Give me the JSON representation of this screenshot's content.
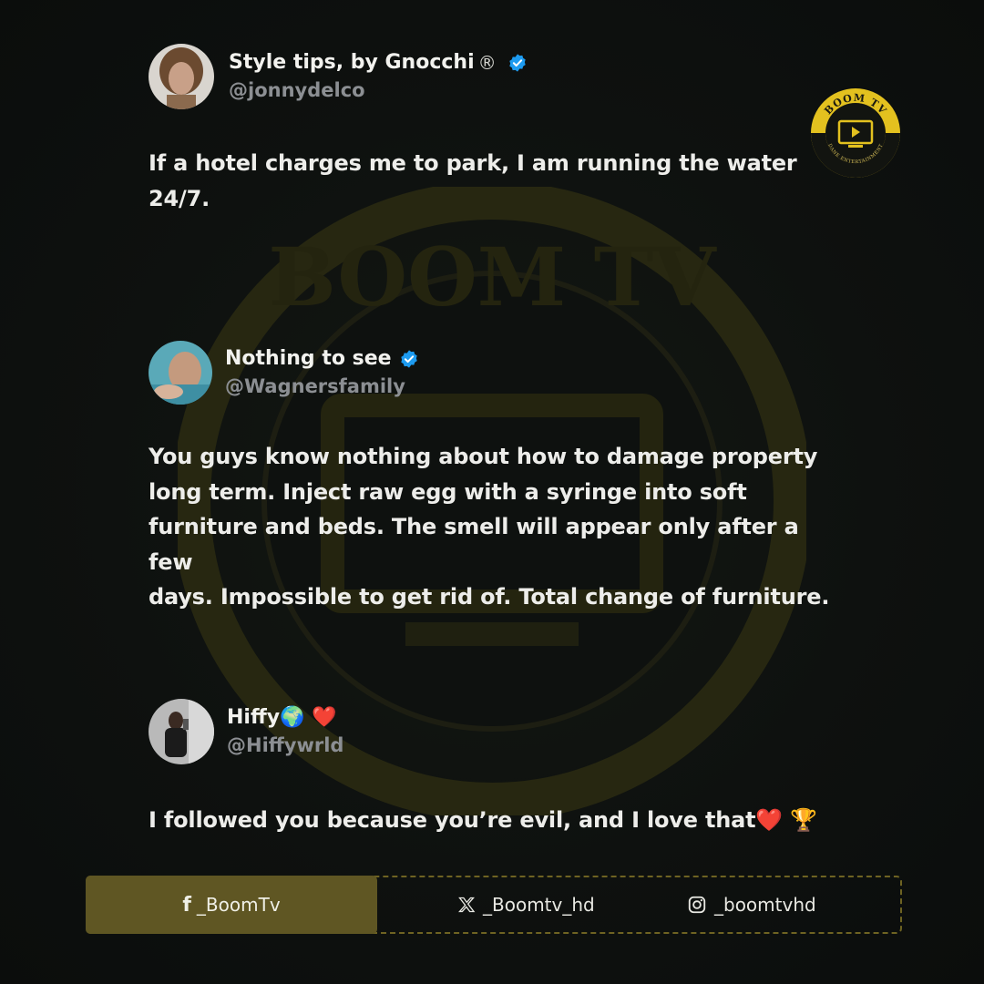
{
  "logo": {
    "text": "BOOM TV",
    "subtext": "DANE ENTERTAINMENT",
    "icon": "play-screen-icon",
    "color": "#e3c11f"
  },
  "tweets": [
    {
      "display_name": "Style tips, by Gnocchi",
      "name_suffix": "®",
      "handle": "@jonnydelco",
      "verified": true,
      "text_lines": [
        "If a hotel charges me to park, I am running the water",
        "24/7."
      ]
    },
    {
      "display_name": "Nothing to see",
      "handle": "@Wagnersfamily",
      "verified": true,
      "text_lines": [
        "You guys know nothing about how to damage property",
        "long term. Inject raw egg with a syringe into soft",
        "furniture and beds. The smell will appear only after a few",
        "days. Impossible to get rid of. Total change of furniture."
      ]
    },
    {
      "display_name": "Hiffy🌍 ❤️",
      "handle": "@Hiffywrld",
      "verified": false,
      "text_lines": [
        "I followed you because you’re evil, and I love that❤️ 🏆"
      ]
    }
  ],
  "footer": {
    "facebook": {
      "icon": "facebook-icon",
      "label": "_BoomTv"
    },
    "x": {
      "icon": "x-icon",
      "label": "_Boomtv_hd"
    },
    "instagram": {
      "icon": "instagram-icon",
      "label": "_boomtvhd"
    }
  },
  "colors": {
    "background": "#0d100f",
    "accent_gold": "#e3c11f",
    "footer_fill": "#5f5623",
    "verified_blue": "#1d9bf0",
    "handle_gray": "#8c8f93"
  }
}
